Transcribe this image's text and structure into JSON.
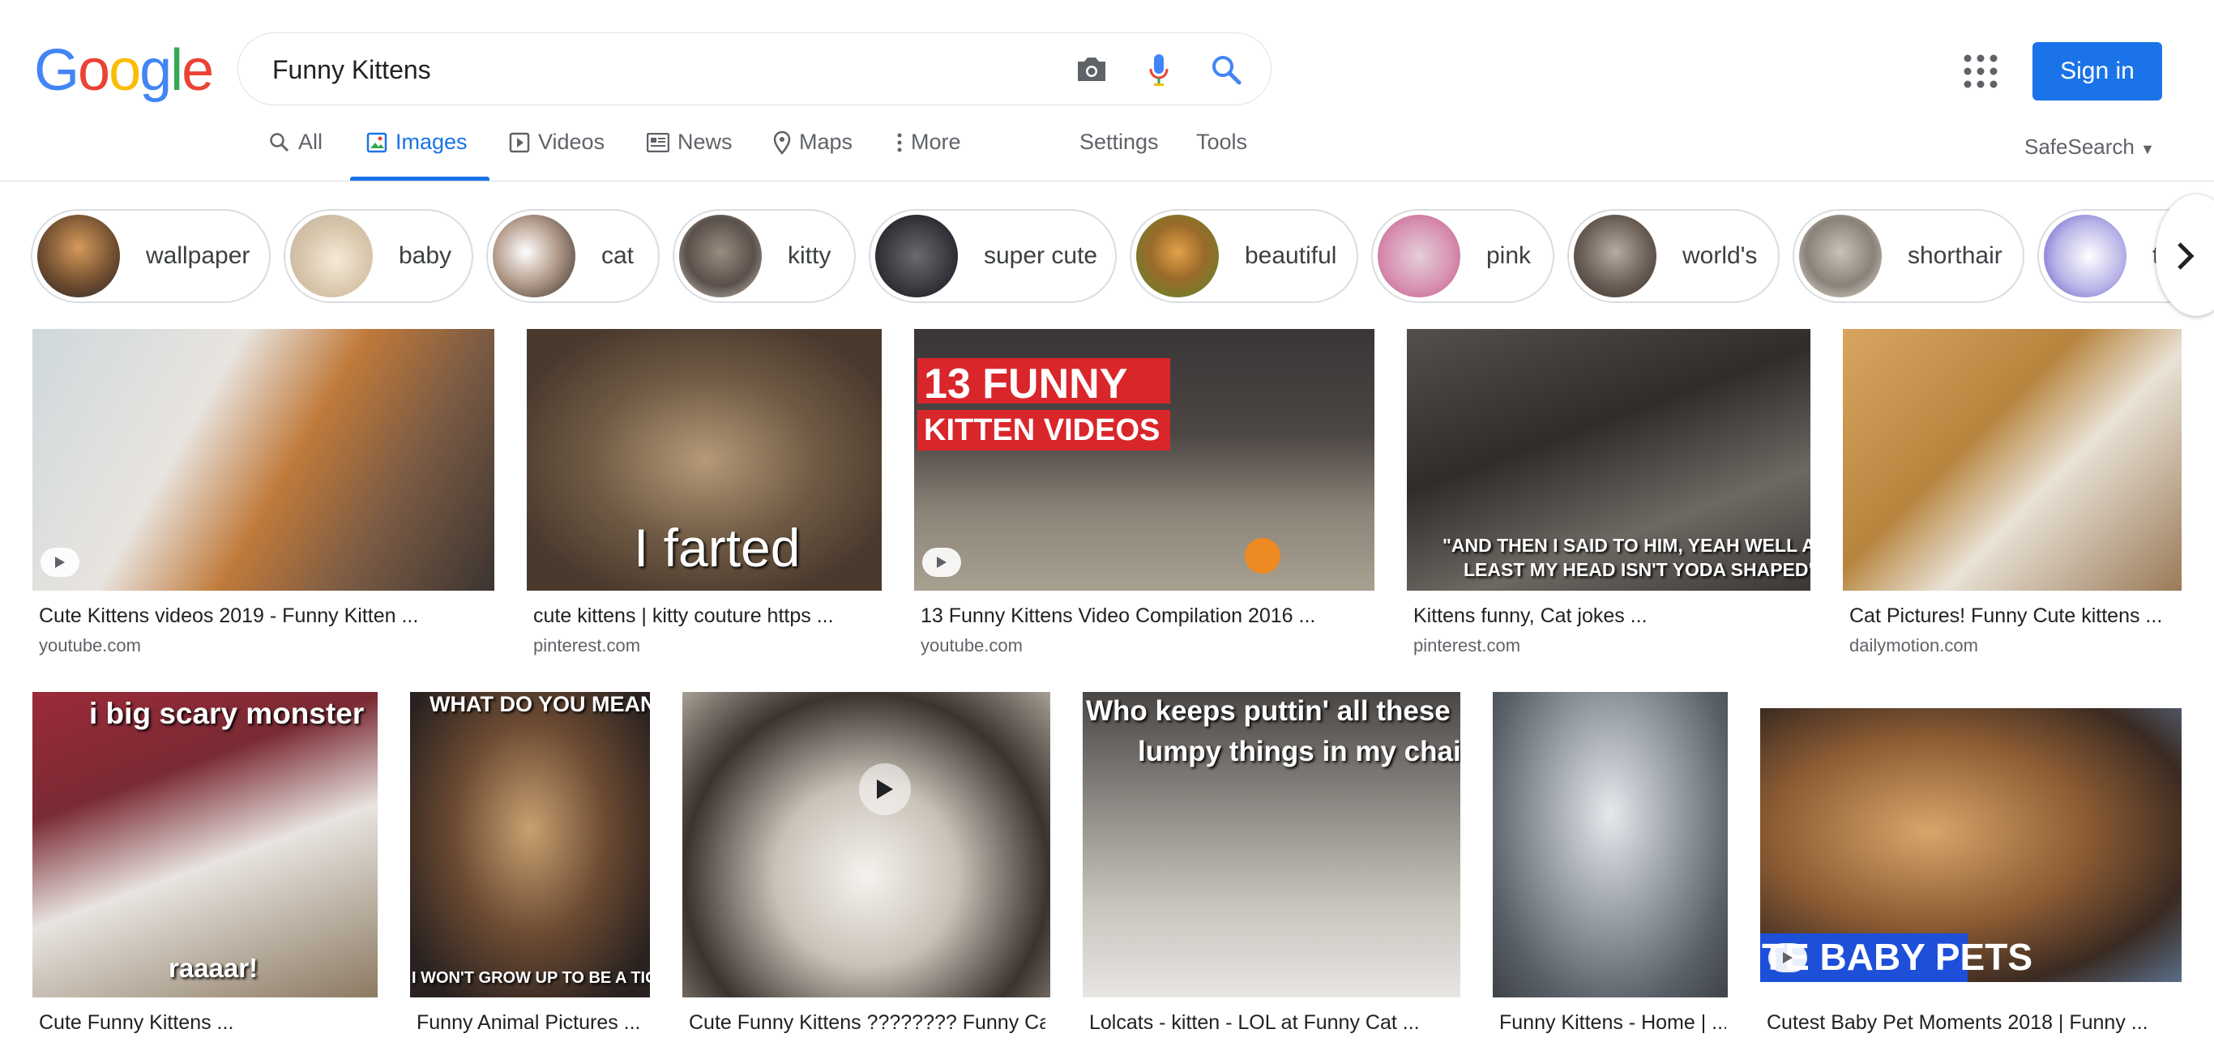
{
  "logo": {
    "letters": [
      "G",
      "o",
      "o",
      "g",
      "l",
      "e"
    ],
    "colors": [
      "#4285f4",
      "#ea4335",
      "#fbbc05",
      "#4285f4",
      "#34a853",
      "#ea4335"
    ]
  },
  "search": {
    "value": "Funny Kittens",
    "placeholder": ""
  },
  "header": {
    "sign_in": "Sign in"
  },
  "tabs": [
    {
      "label": "All"
    },
    {
      "label": "Images"
    },
    {
      "label": "Videos"
    },
    {
      "label": "News"
    },
    {
      "label": "Maps"
    },
    {
      "label": "More"
    },
    {
      "label": "Settings"
    },
    {
      "label": "Tools"
    }
  ],
  "safesearch": "SafeSearch",
  "chips": [
    "wallpaper",
    "baby",
    "cat",
    "kitty",
    "super cute",
    "beautiful",
    "pink",
    "world's",
    "shorthair",
    "tr"
  ],
  "results": [
    {
      "title": "Cute Kittens videos 2019 - Funny Kitten ...",
      "source": "youtube.com"
    },
    {
      "title": "cute kittens | kitty couture https ...",
      "source": "pinterest.com",
      "overlay": "I farted"
    },
    {
      "title": "13 Funny Kittens Video Compilation 2016 ...",
      "source": "youtube.com",
      "overlay": "13 FUNNY",
      "overlay2": "KITTEN VIDEOS"
    },
    {
      "title": "Kittens funny, Cat jokes ...",
      "source": "pinterest.com",
      "overlay": "\"AND THEN I SAID TO HIM, YEAH WELL AT",
      "overlay2": "LEAST MY HEAD ISN'T YODA SHAPED\""
    },
    {
      "title": "Cat Pictures! Funny Cute kittens ...",
      "source": "dailymotion.com"
    },
    {
      "title": "Cute Funny Kittens ...",
      "overlay": "i big scary monster",
      "overlay2": "raaaar!"
    },
    {
      "title": "Funny Animal Pictures ...",
      "overlay": "WHAT DO YOU MEAN",
      "overlay2": "I WON'T GROW UP TO BE A TIGER?"
    },
    {
      "title": "Cute Funny Kittens ???????? Funny Ca..."
    },
    {
      "title": "Lolcats - kitten - LOL at Funny Cat ...",
      "overlay": "Who keeps puttin' all these",
      "overlay2": "lumpy things in my chair?"
    },
    {
      "title": "Funny Kittens - Home | ..."
    },
    {
      "title": "Cutest Baby Pet Moments 2018 | Funny ...",
      "overlay": "TE BABY PETS"
    }
  ]
}
